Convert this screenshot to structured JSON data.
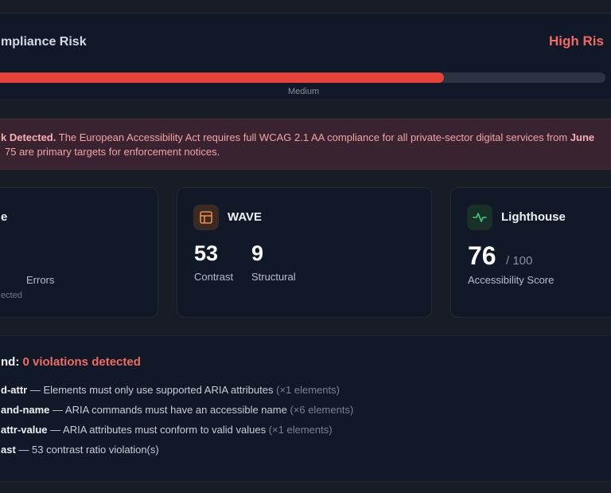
{
  "risk": {
    "title": "mpliance Risk",
    "level": "High Ris",
    "scale_label": "Medium",
    "progress_fraction": 0.74,
    "colors": {
      "fill": "#e8413a",
      "track": "#2d3340",
      "level_text": "#f36a61"
    }
  },
  "alert": {
    "line1_strong": "k Detected.",
    "line1_text": " The European Accessibility Act requires full WCAG 2.1 AA compliance for all private-sector digital services from ",
    "line1_strong_end": "June",
    "line2_text": "75 are primary targets for enforcement notices."
  },
  "tools": {
    "axe": {
      "title": "e",
      "stat_label": "Errors",
      "sub_label": "ected"
    },
    "wave": {
      "icon": "layout-icon",
      "title": "WAVE",
      "contrast_value": "53",
      "contrast_label": "Contrast",
      "structural_value": "9",
      "structural_label": "Structural"
    },
    "lighthouse": {
      "icon": "pulse-icon",
      "title": "Lighthouse",
      "score": "76",
      "score_of": "/ 100",
      "score_label": "Accessibility Score"
    }
  },
  "violations": {
    "title_prefix": "nd:",
    "count_text": "0 violations detected",
    "items": [
      {
        "code": "d-attr",
        "desc": " — Elements must only use supported ARIA attributes ",
        "count": "(×1 elements)"
      },
      {
        "code": "and-name",
        "desc": " — ARIA commands must have an accessible name ",
        "count": "(×6 elements)"
      },
      {
        "code": "attr-value",
        "desc": " — ARIA attributes must conform to valid values ",
        "count": "(×1 elements)"
      },
      {
        "code": "ast",
        "desc": " — 53 contrast ratio violation(s)",
        "count": ""
      }
    ]
  }
}
